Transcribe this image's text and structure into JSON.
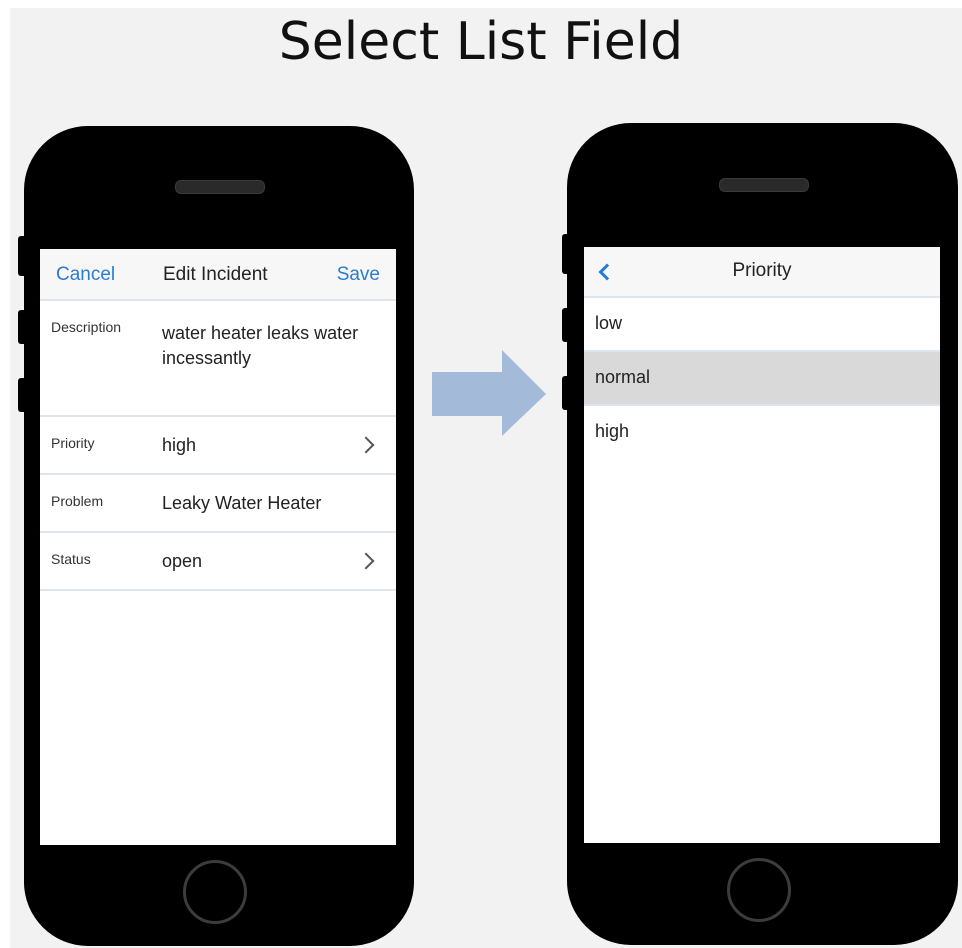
{
  "slide_title": "Select List Field",
  "edit_screen": {
    "nav": {
      "cancel": "Cancel",
      "title": "Edit Incident",
      "save": "Save"
    },
    "fields": [
      {
        "label": "Description",
        "value": "water heater leaks water incessantly",
        "has_chevron": false
      },
      {
        "label": "Priority",
        "value": "high",
        "has_chevron": true
      },
      {
        "label": "Problem",
        "value": "Leaky Water Heater",
        "has_chevron": false
      },
      {
        "label": "Status",
        "value": "open",
        "has_chevron": true
      }
    ]
  },
  "picker_screen": {
    "nav": {
      "title": "Priority",
      "back_icon": "chevron-left-icon"
    },
    "options": [
      "low",
      "normal",
      "high"
    ],
    "selected": "normal"
  },
  "colors": {
    "accent": "#2b7bd0",
    "arrow": "#a3bad8",
    "selected_row": "#d9d9d9",
    "divider": "#dde6ee"
  }
}
